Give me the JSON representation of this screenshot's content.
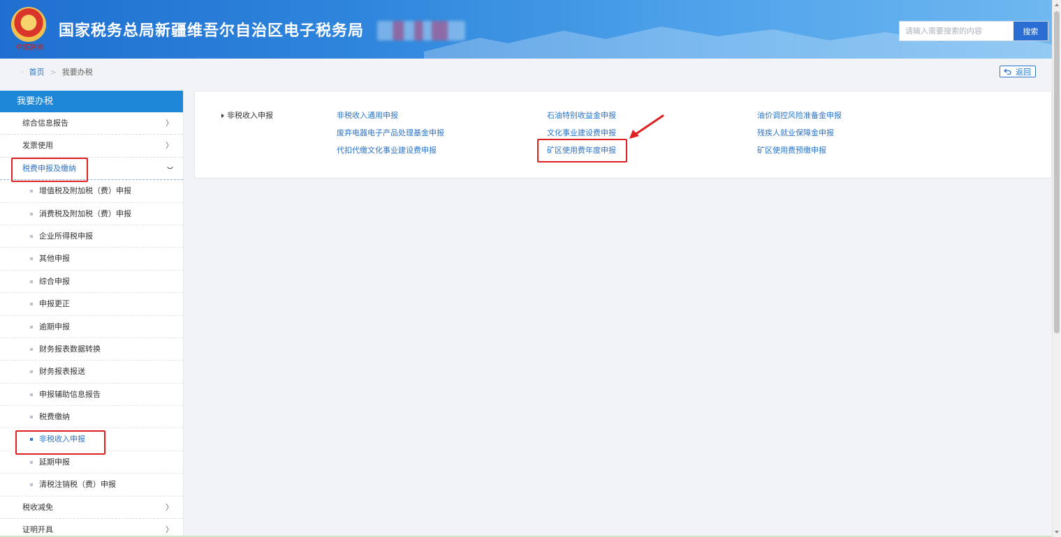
{
  "header": {
    "title": "国家税务总局新疆维吾尔自治区电子税务局",
    "emblem_caption": "中国税务",
    "search": {
      "placeholder": "请输入需要搜索的内容",
      "button_label": "搜索"
    }
  },
  "breadcrumb": {
    "home": "首页",
    "current": "我要办税",
    "separator": ">",
    "back_label": "返回"
  },
  "sidebar": {
    "title": "我要办税",
    "items_before": [
      {
        "label": "综合信息报告",
        "chevron": "〉"
      },
      {
        "label": "发票使用",
        "chevron": "〉"
      }
    ],
    "open_item": {
      "label": "税费申报及缴纳"
    },
    "sub_items": [
      {
        "label": "增值税及附加税（费）申报"
      },
      {
        "label": "消费税及附加税（费）申报"
      },
      {
        "label": "企业所得税申报"
      },
      {
        "label": "其他申报"
      },
      {
        "label": "综合申报"
      },
      {
        "label": "申报更正"
      },
      {
        "label": "逾期申报"
      },
      {
        "label": "财务报表数据转换"
      },
      {
        "label": "财务报表报送"
      },
      {
        "label": "申报辅助信息报告"
      },
      {
        "label": "税费缴纳"
      },
      {
        "label": "非税收入申报"
      },
      {
        "label": "延期申报"
      },
      {
        "label": "清税注销税（费）申报"
      }
    ],
    "items_after": [
      {
        "label": "税收减免",
        "chevron": "〉"
      },
      {
        "label": "证明开具",
        "chevron": "〉"
      }
    ]
  },
  "panel": {
    "category": "非税收入申报",
    "links": [
      [
        "非税收入通用申报",
        "石油特别收益金申报",
        "油价调控风险准备金申报"
      ],
      [
        "废弃电器电子产品处理基金申报",
        "文化事业建设费申报",
        "残疾人就业保障金申报"
      ],
      [
        "代扣代缴文化事业建设费申报",
        "矿区使用费年度申报",
        "矿区使用费预缴申报"
      ]
    ]
  },
  "colors": {
    "accent": "#2a74c9",
    "highlight": "#e02020",
    "header_start": "#1f6fd0",
    "sidebar_head": "#1e87d8"
  }
}
